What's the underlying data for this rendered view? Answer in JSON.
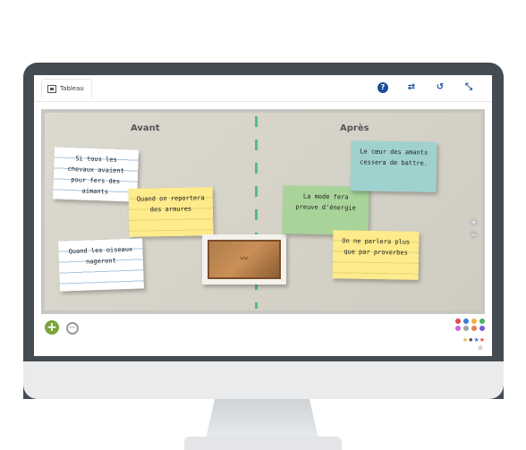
{
  "toolbar": {
    "tab_label": "Tableau",
    "icons": [
      "help-icon",
      "swap-icon",
      "history-icon",
      "collapse-icon"
    ]
  },
  "board": {
    "column_before": "Avant",
    "column_after": "Après",
    "cards": [
      {
        "id": "card1",
        "text": "Si tous les chevaux avaient pour fers des aimants",
        "color": "#ffffff"
      },
      {
        "id": "card2",
        "text": "Quand on reportera des armures",
        "color": "#fdeb8c"
      },
      {
        "id": "card3",
        "text": "Quand les oiseaux nageront",
        "color": "#ffffff"
      },
      {
        "id": "card5",
        "text": "La mode fera preuve d'énergie",
        "color": "#a8d49a"
      },
      {
        "id": "card6",
        "text": "Le cœur des amants cessera de battre.",
        "color": "#9fd2cf"
      },
      {
        "id": "card7",
        "text": "On ne parlera plus que par proverbes",
        "color": "#fdeb8c"
      }
    ]
  },
  "bottom": {
    "palette_colors": [
      "#e24b4b",
      "#3a7bd5",
      "#f2b33d",
      "#46b36b",
      "#c66bd6",
      "#a4a4a4",
      "#e0824d",
      "#7b5ad6"
    ],
    "stars": [
      "#e3b341",
      "#333333",
      "#3a7bd5",
      "#e24b4b"
    ]
  }
}
